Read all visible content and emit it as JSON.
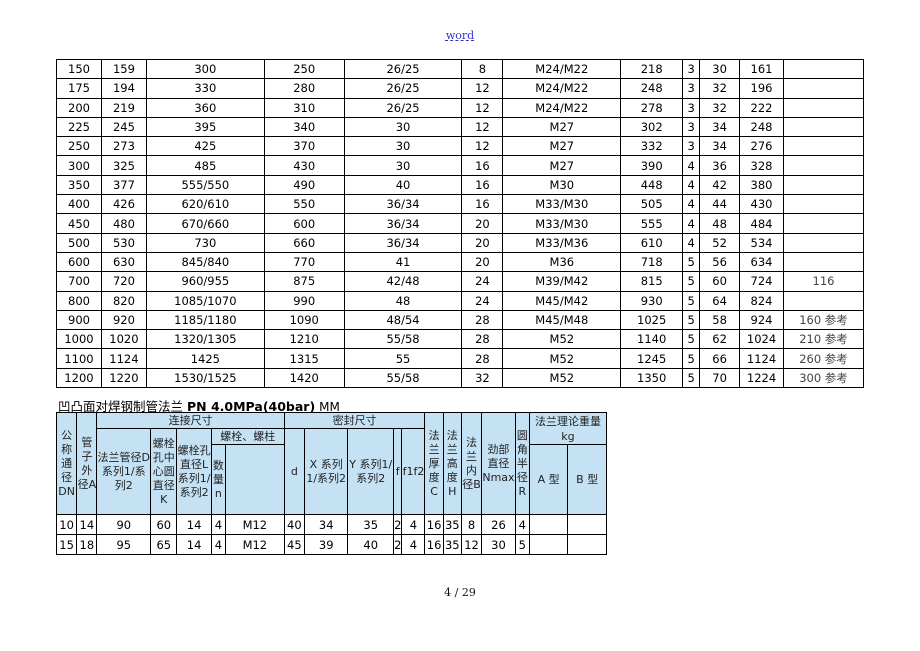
{
  "header": {
    "label": "word"
  },
  "top_table": {
    "rows": [
      [
        "150",
        "159",
        "300",
        "250",
        "26/25",
        "8",
        "M24/M22",
        "218",
        "3",
        "30",
        "161",
        ""
      ],
      [
        "175",
        "194",
        "330",
        "280",
        "26/25",
        "12",
        "M24/M22",
        "248",
        "3",
        "32",
        "196",
        ""
      ],
      [
        "200",
        "219",
        "360",
        "310",
        "26/25",
        "12",
        "M24/M22",
        "278",
        "3",
        "32",
        "222",
        ""
      ],
      [
        "225",
        "245",
        "395",
        "340",
        "30",
        "12",
        "M27",
        "302",
        "3",
        "34",
        "248",
        ""
      ],
      [
        "250",
        "273",
        "425",
        "370",
        "30",
        "12",
        "M27",
        "332",
        "3",
        "34",
        "276",
        ""
      ],
      [
        "300",
        "325",
        "485",
        "430",
        "30",
        "16",
        "M27",
        "390",
        "4",
        "36",
        "328",
        ""
      ],
      [
        "350",
        "377",
        "555/550",
        "490",
        "40",
        "16",
        "M30",
        "448",
        "4",
        "42",
        "380",
        ""
      ],
      [
        "400",
        "426",
        "620/610",
        "550",
        "36/34",
        "16",
        "M33/M30",
        "505",
        "4",
        "44",
        "430",
        ""
      ],
      [
        "450",
        "480",
        "670/660",
        "600",
        "36/34",
        "20",
        "M33/M30",
        "555",
        "4",
        "48",
        "484",
        ""
      ],
      [
        "500",
        "530",
        "730",
        "660",
        "36/34",
        "20",
        "M33/M36",
        "610",
        "4",
        "52",
        "534",
        ""
      ],
      [
        "600",
        "630",
        "845/840",
        "770",
        "41",
        "20",
        "M36",
        "718",
        "5",
        "56",
        "634",
        ""
      ],
      [
        "700",
        "720",
        "960/955",
        "875",
        "42/48",
        "24",
        "M39/M42",
        "815",
        "5",
        "60",
        "724",
        "116"
      ],
      [
        "800",
        "820",
        "1085/1070",
        "990",
        "48",
        "24",
        "M45/M42",
        "930",
        "5",
        "64",
        "824",
        ""
      ],
      [
        "900",
        "920",
        "1185/1180",
        "1090",
        "48/54",
        "28",
        "M45/M48",
        "1025",
        "5",
        "58",
        "924",
        "160 参考"
      ],
      [
        "1000",
        "1020",
        "1320/1305",
        "1210",
        "55/58",
        "28",
        "M52",
        "1140",
        "5",
        "62",
        "1024",
        "210 参考"
      ],
      [
        "1100",
        "1124",
        "1425",
        "1315",
        "55",
        "28",
        "M52",
        "1245",
        "5",
        "66",
        "1124",
        "260 参考"
      ],
      [
        "1200",
        "1220",
        "1530/1525",
        "1420",
        "55/58",
        "32",
        "M52",
        "1350",
        "5",
        "70",
        "1224",
        "300 参考"
      ]
    ]
  },
  "section2": {
    "title_cn": "凹凸面对焊钢制管法兰",
    "title_bold": "PN 4.0MPa(40bar)",
    "title_unit": "MM"
  },
  "bottom_table": {
    "headers": {
      "dn": "公称通径DN",
      "a": "管子外径A",
      "connect_group": "连接尺寸",
      "d_flange": "法兰管径D 系列1/系列2",
      "k": "螺栓孔中心圆直径K",
      "l": "螺栓孔直径L系列1/系列2",
      "bolt_group": "螺栓、螺柱",
      "n": "数量n",
      "bolt_spec": "",
      "seal_group": "密封尺寸",
      "d_seal": "d",
      "x": "X 系列1/系列2",
      "y": "Y 系列1/系列2",
      "f": "f",
      "f1f2": "f1f2",
      "c": "法兰厚度C",
      "h": "法兰高度H",
      "b": "法兰内径B",
      "nmax": "劲部直径Nmax",
      "r": "圆角半径R",
      "weight_group": "法兰理论重量kg",
      "type_a": "A 型",
      "type_b": "B 型"
    },
    "rows": [
      [
        "10",
        "14",
        "90",
        "60",
        "14",
        "4",
        "M12",
        "40",
        "34",
        "35",
        "2",
        "4",
        "16",
        "35",
        "8",
        "26",
        "4",
        "",
        ""
      ],
      [
        "15",
        "18",
        "95",
        "65",
        "14",
        "4",
        "M12",
        "45",
        "39",
        "40",
        "2",
        "4",
        "16",
        "35",
        "12",
        "30",
        "5",
        "",
        ""
      ]
    ]
  },
  "footer": {
    "page_indicator": "4 / 29"
  }
}
